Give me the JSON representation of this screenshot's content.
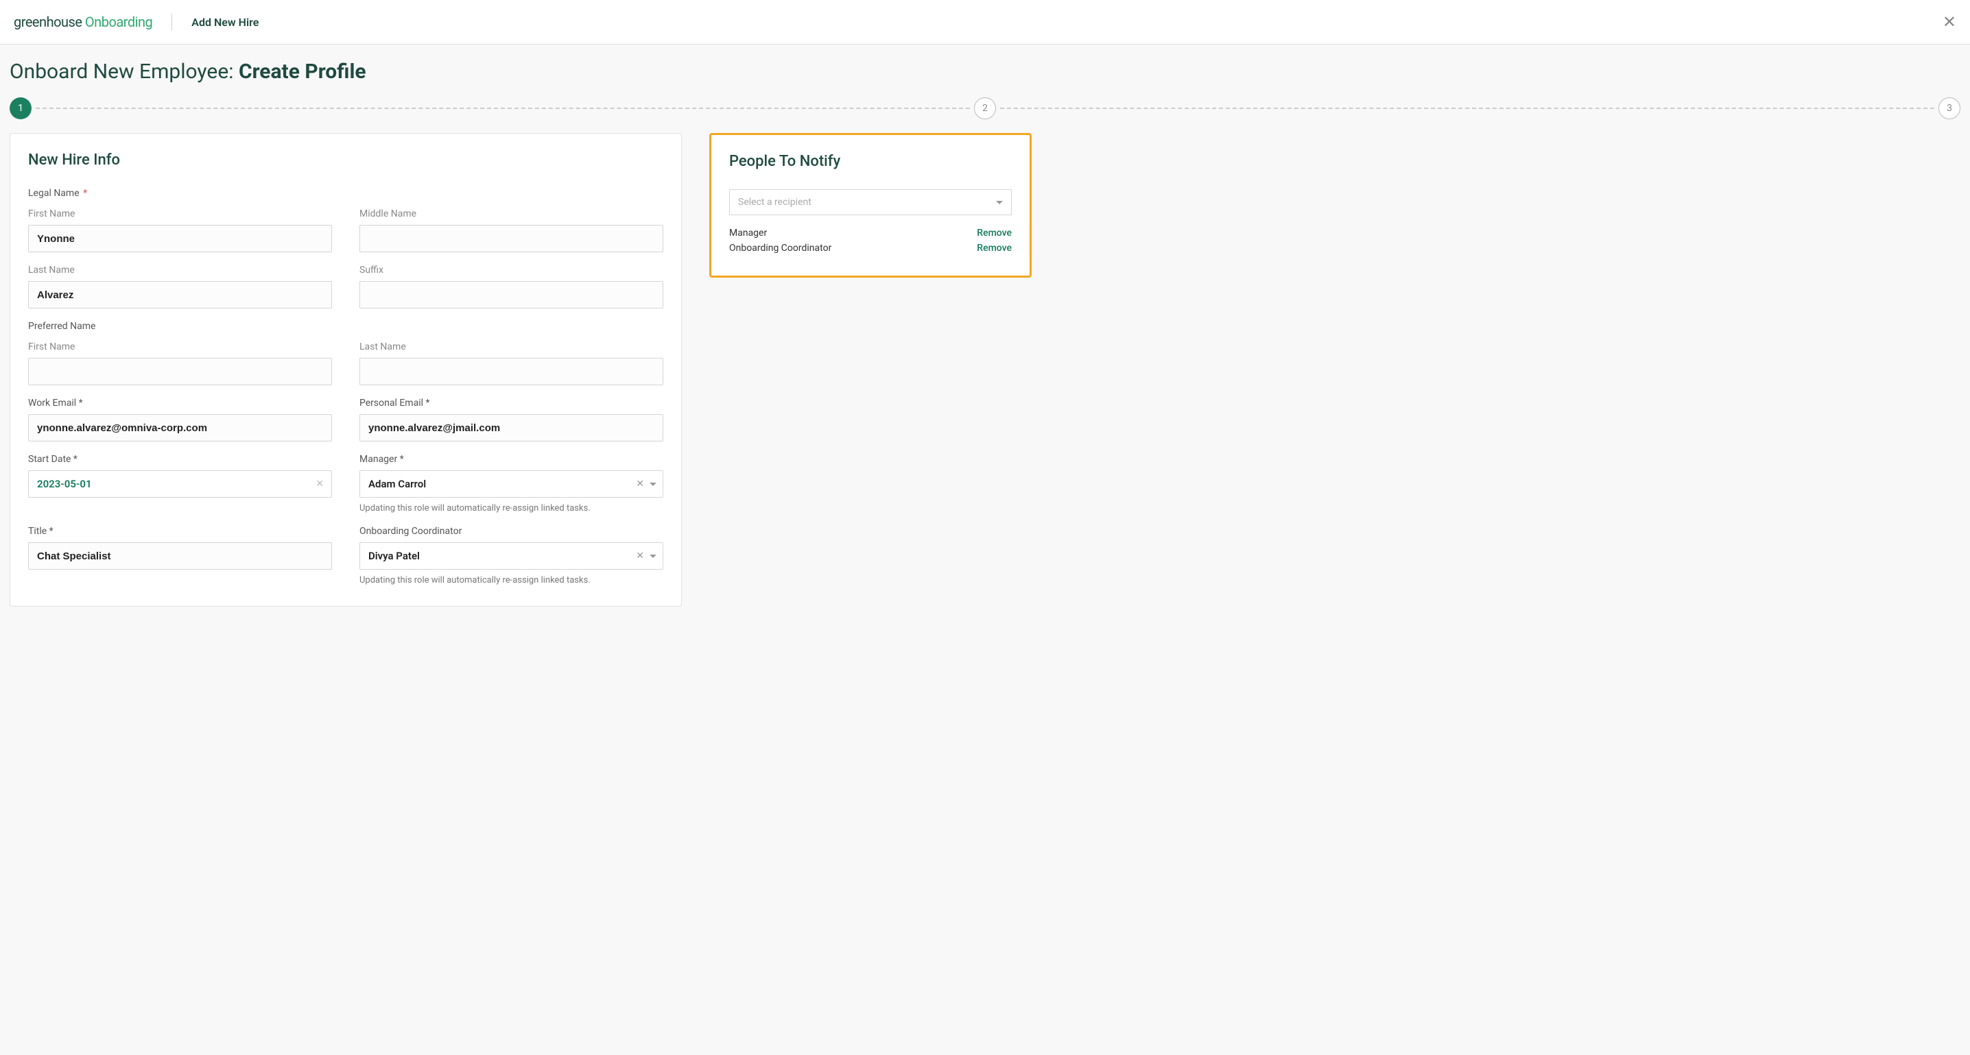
{
  "header": {
    "logo_greenhouse": "greenhouse",
    "logo_onboarding": "Onboarding",
    "title": "Add New Hire"
  },
  "page": {
    "title_pre": "Onboard New Employee: ",
    "title_bold": "Create Profile"
  },
  "stepper": {
    "steps": [
      "1",
      "2",
      "3"
    ],
    "active_index": 0
  },
  "form": {
    "card_title": "New Hire Info",
    "legal_name_label": "Legal Name",
    "preferred_name_label": "Preferred Name",
    "first_name_label": "First Name",
    "middle_name_label": "Middle Name",
    "last_name_label": "Last Name",
    "suffix_label": "Suffix",
    "work_email_label": "Work Email",
    "personal_email_label": "Personal Email",
    "start_date_label": "Start Date",
    "manager_label": "Manager",
    "title_label": "Title",
    "coordinator_label": "Onboarding Coordinator",
    "role_help": "Updating this role will automatically re-assign linked tasks.",
    "values": {
      "first_name": "Ynonne",
      "middle_name": "",
      "last_name": "Alvarez",
      "suffix": "",
      "pref_first": "",
      "pref_last": "",
      "work_email": "ynonne.alvarez@omniva-corp.com",
      "personal_email": "ynonne.alvarez@jmail.com",
      "start_date": "2023-05-01",
      "manager": "Adam Carrol",
      "title": "Chat Specialist",
      "coordinator": "Divya Patel"
    }
  },
  "notify": {
    "card_title": "People To Notify",
    "placeholder": "Select a recipient",
    "remove_label": "Remove",
    "recipients": [
      {
        "label": "Manager"
      },
      {
        "label": "Onboarding Coordinator"
      }
    ]
  }
}
